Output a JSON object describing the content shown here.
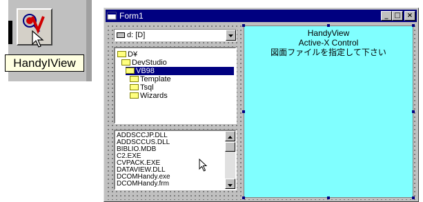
{
  "toolbox": {
    "tooltip": "HandyIView",
    "tool_icon": "handyview-control-icon"
  },
  "form": {
    "title": "Form1",
    "minimize_label": "_",
    "maximize_label": "□",
    "close_label": "×"
  },
  "drive_combo": {
    "value": "d: [D]"
  },
  "dir_list": {
    "items": [
      "D¥",
      "DevStudio",
      "VB98",
      "Template",
      "Tsql",
      "Wizards"
    ],
    "selected": "VB98"
  },
  "file_list": {
    "items": [
      "ADDSCCJP.DLL",
      "ADDSCCUS.DLL",
      "BIBLIO.MDB",
      "C2.EXE",
      "CVPACK.EXE",
      "DATAVIEW.DLL",
      "DCOMHandy.exe",
      "DCOMHandy.frm"
    ]
  },
  "activex": {
    "line1": "HandyView",
    "line2": "Active-X Control",
    "line3": "図面ファイルを指定して下さい"
  },
  "colors": {
    "titlebar": "#000080",
    "control_bg": "#80ffff",
    "window_face": "#c0c0c0"
  }
}
